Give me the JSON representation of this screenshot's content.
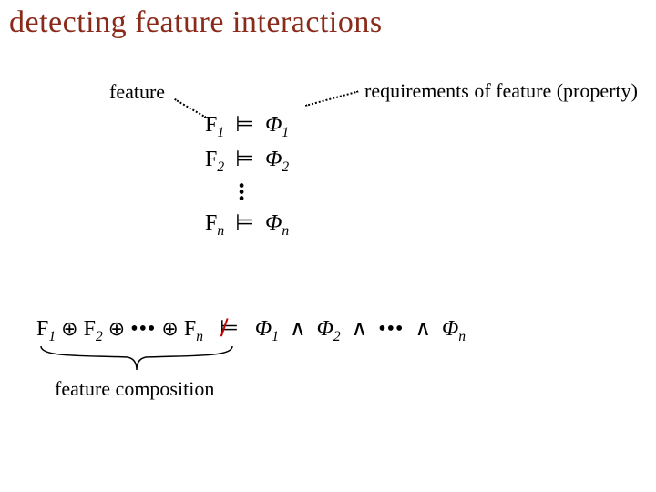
{
  "title": "detecting feature interactions",
  "labels": {
    "feature": "feature",
    "requirements": "requirements of feature (property)",
    "composition": "feature composition"
  },
  "sym": {
    "F": "F",
    "phi": "Φ",
    "models": "⊨",
    "wedge": "∧",
    "oplus": "⊕",
    "dots3": "•••",
    "sub1": "1",
    "sub2": "2",
    "subn": "n"
  },
  "chart_data": {
    "type": "table",
    "title": "Per-feature satisfaction and composed violation",
    "rows": [
      {
        "feature": "F1",
        "relation": "models",
        "property": "Phi1"
      },
      {
        "feature": "F2",
        "relation": "models",
        "property": "Phi2"
      },
      {
        "feature": "Fn",
        "relation": "models",
        "property": "Phin"
      }
    ],
    "composition": {
      "lhs": "F1 ⊕ F2 ⊕ … ⊕ Fn",
      "relation": "not-models",
      "rhs": "Phi1 ∧ Phi2 ∧ … ∧ Phin"
    }
  }
}
